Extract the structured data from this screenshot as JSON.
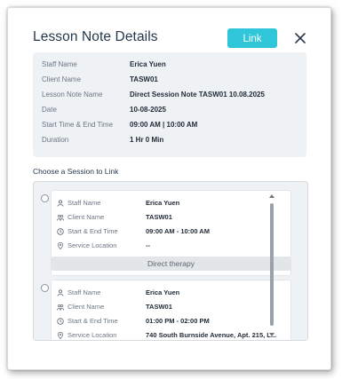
{
  "modal": {
    "title": "Lesson Note Details",
    "link_label": "Link",
    "accent_color": "#2fc6d9"
  },
  "details": [
    {
      "label": "Staff Name",
      "value": "Erica Yuen"
    },
    {
      "label": "Client Name",
      "value": "TASW01"
    },
    {
      "label": "Lesson Note Name",
      "value": "Direct Session Note TASW01 10.08.2025"
    },
    {
      "label": "Date",
      "value": "10-08-2025"
    },
    {
      "label": "Start Time & End Time",
      "value": "09:00 AM | 10:00 AM"
    },
    {
      "label": "Duration",
      "value": "1 Hr 0 Min"
    }
  ],
  "sessions": {
    "title": "Choose a Session to Link",
    "items": [
      {
        "staff_label": "Staff Name",
        "staff": "Erica Yuen",
        "client_label": "Client Name",
        "client": "TASW01",
        "time_label": "Start & End Time",
        "time": "09:00 AM - 10:00 AM",
        "location_label": "Service Location",
        "location": "--",
        "service": "Direct therapy"
      },
      {
        "staff_label": "Staff Name",
        "staff": "Erica Yuen",
        "client_label": "Client Name",
        "client": "TASW01",
        "time_label": "Start & End Time",
        "time": "01:00 PM - 02:00 PM",
        "location_label": "Service Location",
        "location": "740 South Burnside Avenue, Apt. 215, L..."
      }
    ]
  },
  "icons": {
    "close": "close-icon",
    "staff": "person-icon",
    "client": "group-icon",
    "time": "clock-icon",
    "location": "location-pin-icon"
  }
}
